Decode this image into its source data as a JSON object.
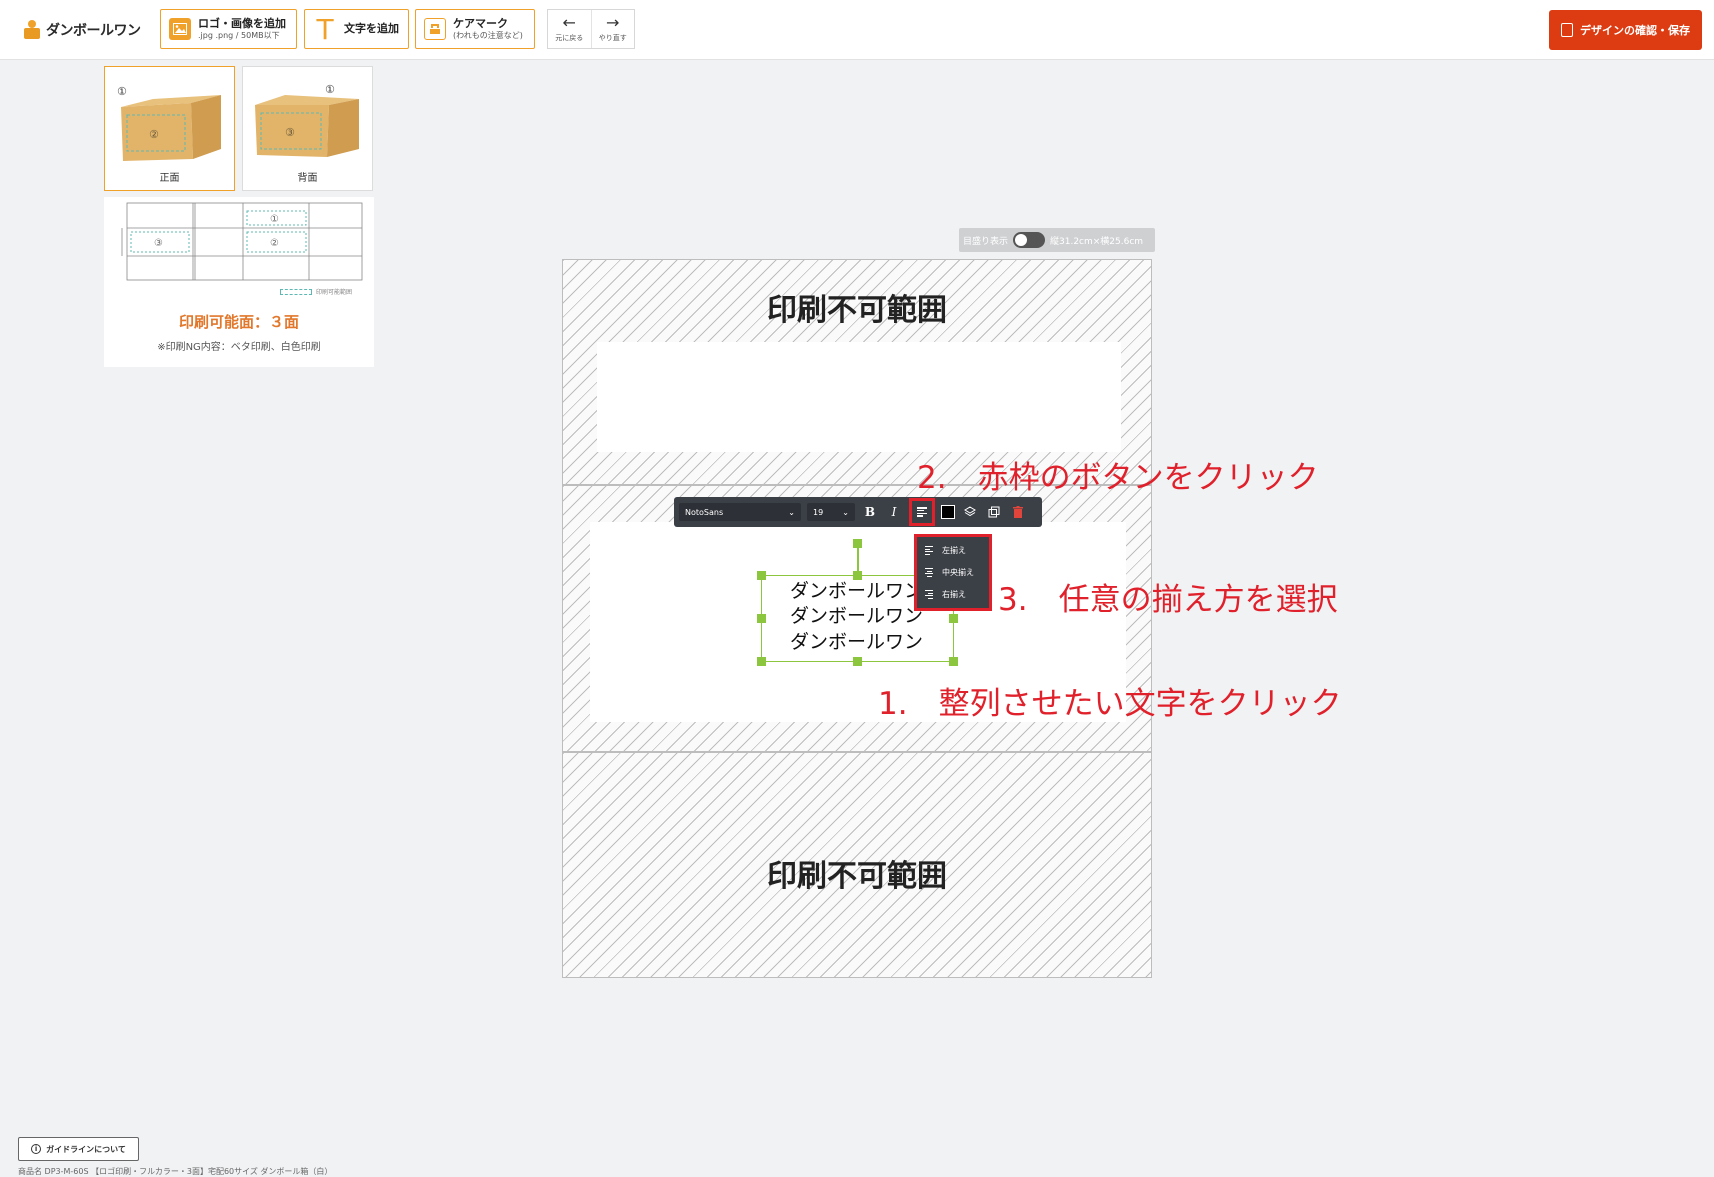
{
  "header": {
    "logo_text": "ダンボールワン",
    "add_image": {
      "label": "ロゴ・画像を追加",
      "sub": ".jpg .png / 50MB以下"
    },
    "add_text": {
      "label": "文字を追加"
    },
    "care_mark": {
      "label": "ケアマーク",
      "sub": "(われもの注意など)"
    },
    "undo_label": "元に戻る",
    "redo_label": "やり直す",
    "save_label": "デザインの確認・保存"
  },
  "sides": [
    {
      "label": "正面",
      "active": true
    },
    {
      "label": "背面",
      "active": false
    }
  ],
  "info": {
    "printable_title": "印刷可能面：３面",
    "ng_note": "※印刷NG内容：ベタ印刷、白色印刷",
    "legend": "印刷可能範囲"
  },
  "canvas": {
    "ruler_label": "目盛り表示",
    "dimensions": "縦31.2cm×横25.6cm",
    "no_print_label": "印刷不可範囲",
    "text_lines": [
      "ダンボールワン",
      "ダンボールワン",
      "ダンボールワン"
    ]
  },
  "toolbar": {
    "font": "NotoSans",
    "size": "19",
    "bold": "B",
    "italic": "I",
    "text_color": "#000000"
  },
  "align_menu": [
    "左揃え",
    "中央揃え",
    "右揃え"
  ],
  "annotations": {
    "step1": "1.　整列させたい文字をクリック",
    "step2": "2.　赤枠のボタンをクリック",
    "step3": "3.　任意の揃え方を選択"
  },
  "footer": {
    "guide_label": "ガイドラインについて",
    "product_name": "商品名 DP3-M-60S 【ロゴ印刷・フルカラー・3面】宅配60サイズ ダンボール箱（白）"
  },
  "colors": {
    "accent": "#f0a12a",
    "save": "#dd3c12",
    "annotation": "#e0202a",
    "selection": "#8cc63f"
  }
}
